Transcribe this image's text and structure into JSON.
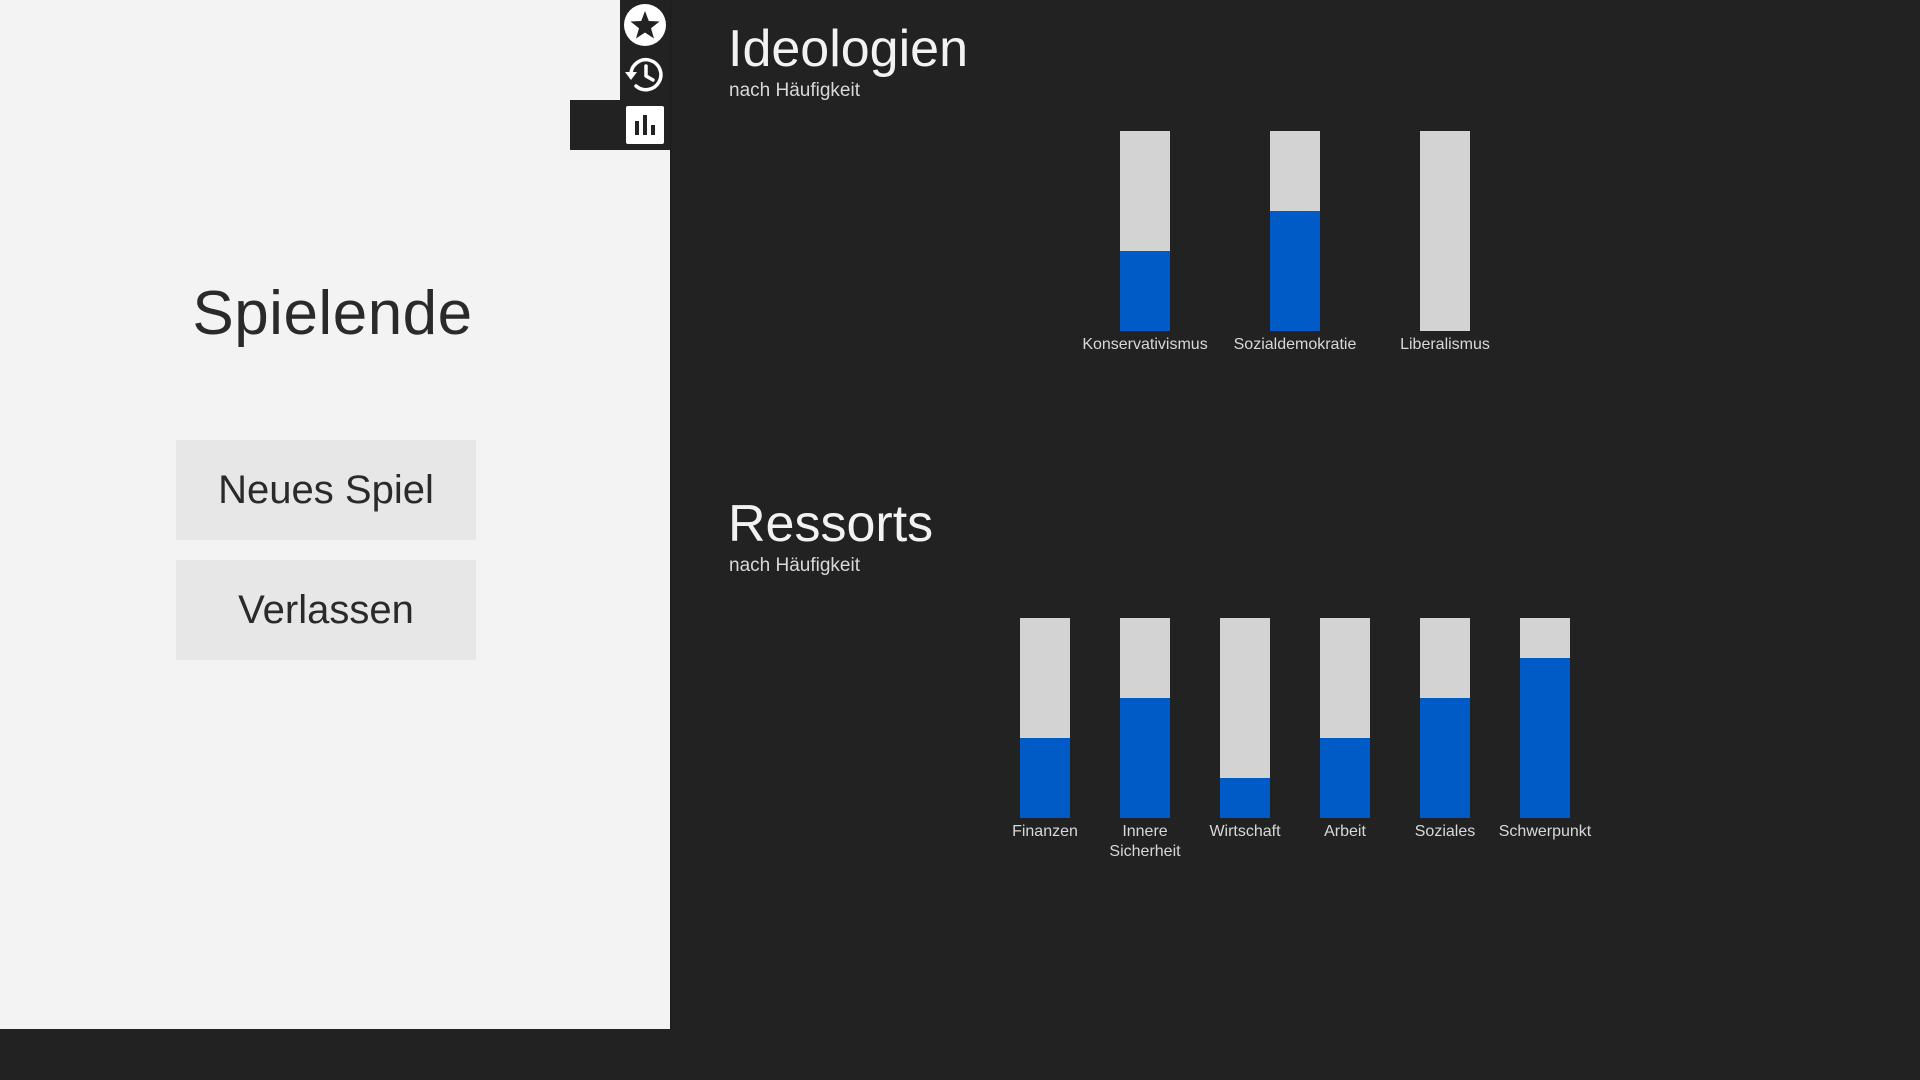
{
  "left_panel": {
    "title": "Spielende",
    "buttons": {
      "new_game": "Neues Spiel",
      "quit": "Verlassen"
    }
  },
  "icon_rail": {
    "icons": [
      "star-icon",
      "history-icon",
      "bar-chart-icon"
    ],
    "active": "bar-chart-icon"
  },
  "colors": {
    "panel_background": "#f3f3f3",
    "dark_background": "#222222",
    "bar_fill": "#005bc6",
    "bar_track": "#d3d3d3"
  },
  "ideologien": {
    "title": "Ideologien",
    "subtitle": "nach Häufigkeit"
  },
  "ressorts": {
    "title": "Ressorts",
    "subtitle": "nach Häufigkeit"
  },
  "chart_data": [
    {
      "type": "bar",
      "title": "Ideologien",
      "subtitle": "nach Häufigkeit",
      "categories": [
        "Konservativismus",
        "Sozialdemokratie",
        "Liberalismus"
      ],
      "values": [
        0.4,
        0.6,
        0.0
      ],
      "ylim": [
        0,
        1
      ]
    },
    {
      "type": "bar",
      "title": "Ressorts",
      "subtitle": "nach Häufigkeit",
      "categories": [
        "Finanzen",
        "Innere Sicherheit",
        "Wirtschaft",
        "Arbeit",
        "Soziales",
        "Schwerpunkt"
      ],
      "values": [
        0.4,
        0.6,
        0.2,
        0.4,
        0.6,
        0.8
      ],
      "ylim": [
        0,
        1
      ]
    }
  ]
}
